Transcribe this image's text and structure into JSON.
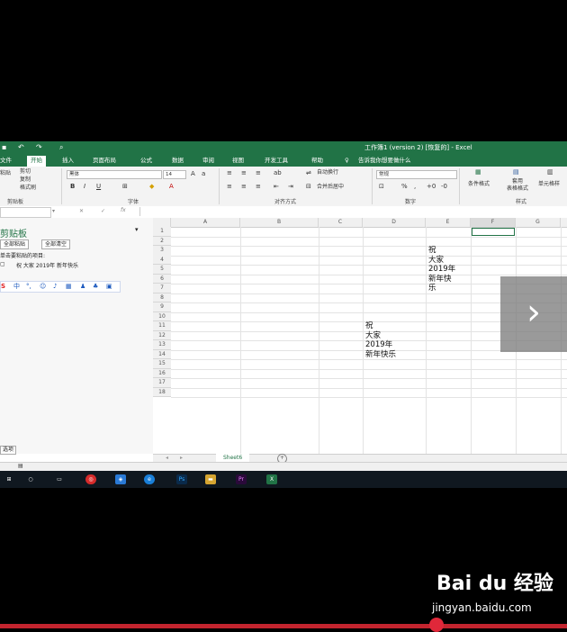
{
  "titlebar": {
    "title": "工作簿1 (version 2) [恢复的] - Excel"
  },
  "tabs": [
    "文件",
    "开始",
    "插入",
    "页面布局",
    "公式",
    "数据",
    "审阅",
    "视图",
    "开发工具",
    "帮助"
  ],
  "tell_me": "告诉我你想要做什么",
  "ribbon": {
    "clipboard": {
      "cut": "剪切",
      "copy": "复制",
      "format_painter": "格式刷",
      "paste": "粘贴",
      "group": "剪贴板"
    },
    "font": {
      "name": "黑体",
      "size": "14",
      "group": "字体"
    },
    "alignment": {
      "wrap": "自动换行",
      "merge": "合并后居中",
      "group": "对齐方式"
    },
    "number": {
      "format": "常规",
      "group": "数字"
    },
    "styles": {
      "conditional": "条件格式",
      "table": "套用\n表格格式",
      "cell": "单元格样",
      "group": "样式"
    }
  },
  "pane": {
    "title": "剪贴板",
    "paste_all": "全部粘贴",
    "clear_all": "全部清空",
    "hint": "单击要粘贴的项目:",
    "item": "祝 大家 2019年 新年快乐",
    "ime": "中",
    "options": "选项"
  },
  "grid": {
    "columns": [
      "A",
      "B",
      "C",
      "D",
      "E",
      "F",
      "G"
    ],
    "rows": [
      "1",
      "2",
      "3",
      "4",
      "5",
      "6",
      "7",
      "8",
      "9",
      "10",
      "11",
      "12",
      "13",
      "14",
      "15",
      "16",
      "17",
      "18"
    ],
    "e_lines": [
      "祝",
      "大家",
      "2019年",
      "新年快",
      "乐"
    ],
    "d_lines": [
      "祝",
      "大家",
      "2019年",
      "新年快乐"
    ]
  },
  "sheet": {
    "tab": "Sheet6",
    "add": "+"
  },
  "watermark": {
    "brand": "Bai du 经验",
    "url": "jingyan.baidu.com"
  },
  "overlay": {
    "next": "›"
  },
  "video_progress_fraction": 0.77
}
